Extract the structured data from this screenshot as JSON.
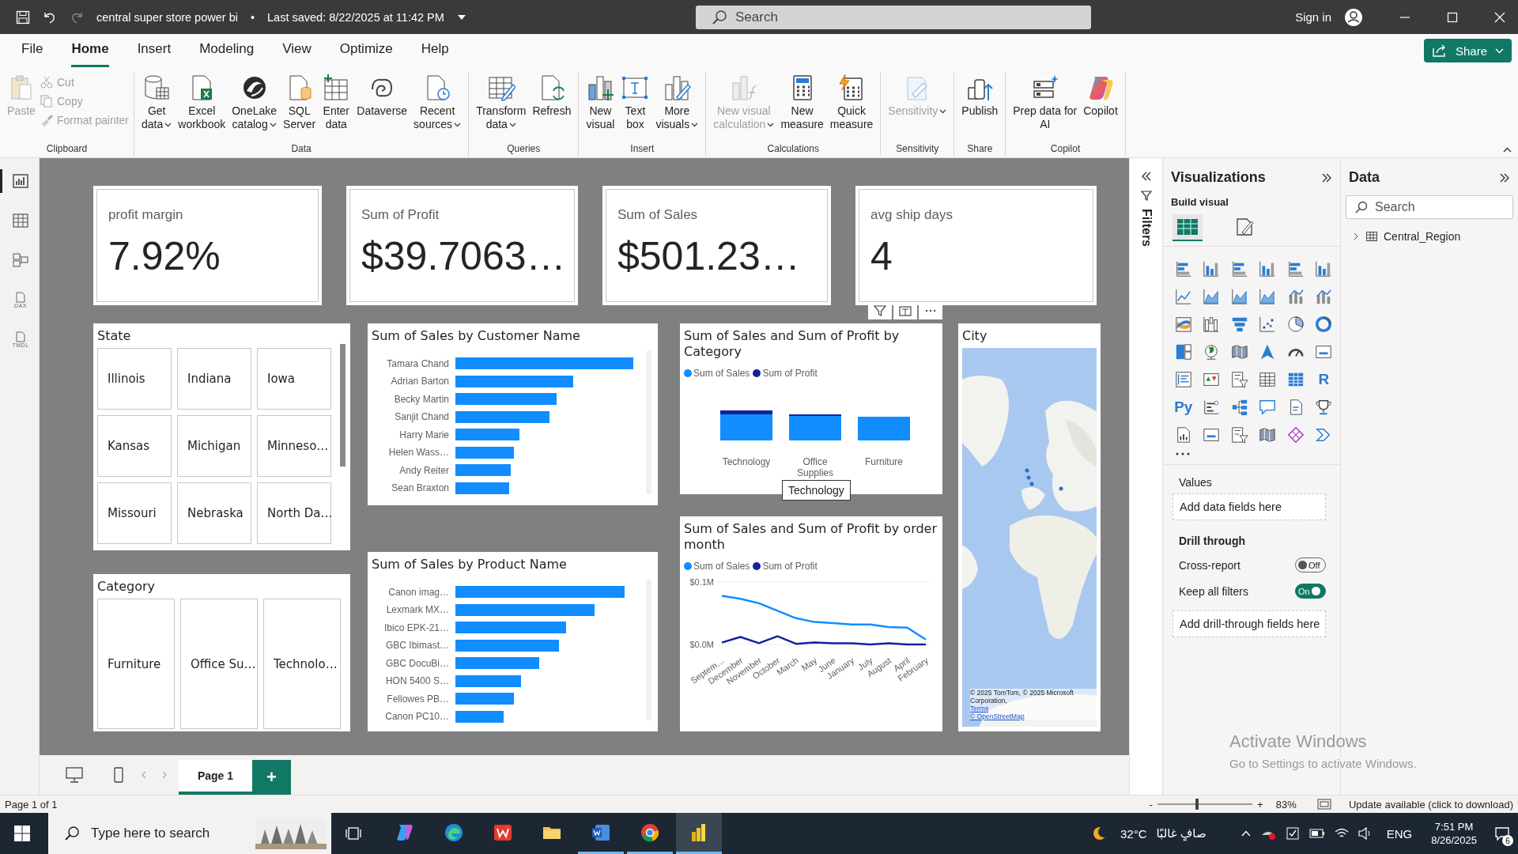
{
  "title_bar": {
    "document_title": "central super store power bi",
    "separator": "•",
    "last_saved": "Last saved: 8/22/2025 at 11:42 PM",
    "search": {
      "placeholder": "Search"
    },
    "sign_in": "Sign in"
  },
  "menu_tabs": [
    {
      "label": "File",
      "selected": false
    },
    {
      "label": "Home",
      "selected": true
    },
    {
      "label": "Insert",
      "selected": false
    },
    {
      "label": "Modeling",
      "selected": false
    },
    {
      "label": "View",
      "selected": false
    },
    {
      "label": "Optimize",
      "selected": false
    },
    {
      "label": "Help",
      "selected": false
    }
  ],
  "share_button": "Share",
  "ribbon": [
    {
      "label": "Clipboard",
      "buttons": [
        {
          "kind": "large",
          "lines": [
            "Paste"
          ],
          "disabled": true,
          "dropdown": false
        },
        {
          "kind": "small",
          "lines": [
            "Cut"
          ],
          "disabled": true,
          "dropdown": false
        },
        {
          "kind": "small",
          "lines": [
            "Copy"
          ],
          "disabled": true,
          "dropdown": false
        },
        {
          "kind": "small",
          "lines": [
            "Format painter"
          ],
          "disabled": true,
          "dropdown": false
        }
      ]
    },
    {
      "label": "Data",
      "buttons": [
        {
          "kind": "large",
          "lines": [
            "Get",
            "data"
          ],
          "disabled": false,
          "dropdown": true
        },
        {
          "kind": "large",
          "lines": [
            "Excel",
            "workbook"
          ],
          "disabled": false,
          "dropdown": false
        },
        {
          "kind": "large",
          "lines": [
            "OneLake",
            "catalog"
          ],
          "disabled": false,
          "dropdown": true
        },
        {
          "kind": "large",
          "lines": [
            "SQL",
            "Server"
          ],
          "disabled": false,
          "dropdown": false
        },
        {
          "kind": "large",
          "lines": [
            "Enter",
            "data"
          ],
          "disabled": false,
          "dropdown": false
        },
        {
          "kind": "large",
          "lines": [
            "Dataverse"
          ],
          "disabled": false,
          "dropdown": false
        },
        {
          "kind": "large",
          "lines": [
            "Recent",
            "sources"
          ],
          "disabled": false,
          "dropdown": true
        }
      ]
    },
    {
      "label": "Queries",
      "buttons": [
        {
          "kind": "large",
          "lines": [
            "Transform",
            "data"
          ],
          "disabled": false,
          "dropdown": true
        },
        {
          "kind": "large",
          "lines": [
            "Refresh"
          ],
          "disabled": false,
          "dropdown": false
        }
      ]
    },
    {
      "label": "Insert",
      "buttons": [
        {
          "kind": "large",
          "lines": [
            "New",
            "visual"
          ],
          "disabled": false,
          "dropdown": false
        },
        {
          "kind": "large",
          "lines": [
            "Text",
            "box"
          ],
          "disabled": false,
          "dropdown": false
        },
        {
          "kind": "large",
          "lines": [
            "More",
            "visuals"
          ],
          "disabled": false,
          "dropdown": true
        }
      ]
    },
    {
      "label": "Calculations",
      "buttons": [
        {
          "kind": "large",
          "lines": [
            "New visual",
            "calculation"
          ],
          "disabled": true,
          "dropdown": true
        },
        {
          "kind": "large",
          "lines": [
            "New",
            "measure"
          ],
          "disabled": false,
          "dropdown": false
        },
        {
          "kind": "large",
          "lines": [
            "Quick",
            "measure"
          ],
          "disabled": false,
          "dropdown": false
        }
      ]
    },
    {
      "label": "Sensitivity",
      "buttons": [
        {
          "kind": "large",
          "lines": [
            "Sensitivity"
          ],
          "disabled": true,
          "dropdown": true
        }
      ]
    },
    {
      "label": "Share",
      "buttons": [
        {
          "kind": "large",
          "lines": [
            "Publish"
          ],
          "disabled": false,
          "dropdown": false
        }
      ]
    },
    {
      "label": "Copilot",
      "buttons": [
        {
          "kind": "large",
          "lines": [
            "Prep data for",
            "AI"
          ],
          "disabled": false,
          "dropdown": false
        },
        {
          "kind": "large",
          "lines": [
            "Copilot"
          ],
          "disabled": false,
          "dropdown": false
        }
      ]
    }
  ],
  "left_nav": [
    {
      "kind": "report",
      "selected": true
    },
    {
      "kind": "table",
      "selected": false
    },
    {
      "kind": "model",
      "selected": false
    },
    {
      "kind": "dax",
      "label": "DAX",
      "selected": false
    },
    {
      "kind": "tmdl",
      "label": "TMDL",
      "selected": false
    }
  ],
  "cards": [
    {
      "title": "profit margin",
      "value": "7.92%"
    },
    {
      "title": "Sum of Profit",
      "value": "$39.7063…"
    },
    {
      "title": "Sum of Sales",
      "value": "$501.23…"
    },
    {
      "title": "avg ship days",
      "value": "4"
    }
  ],
  "slicers": [
    {
      "title": "State",
      "scrollable": true,
      "items": [
        "Illinois",
        "Indiana",
        "Iowa",
        "Kansas",
        "Michigan",
        "Minneso…",
        "Missouri",
        "Nebraska",
        "North Da…"
      ]
    },
    {
      "title": "Category",
      "scrollable": false,
      "items": [
        "Furniture",
        "Office Su…",
        "Technolo…"
      ]
    }
  ],
  "bar_charts": [
    {
      "title": "Sum of Sales by Customer Name",
      "bars": [
        {
          "label": "Tamara Chand"
        },
        {
          "label": "Adrian Barton"
        },
        {
          "label": "Becky Martin"
        },
        {
          "label": "Sanjit Chand"
        },
        {
          "label": "Harry Marie"
        },
        {
          "label": "Helen Wass…"
        },
        {
          "label": "Andy Reiter"
        },
        {
          "label": "Sean Braxton"
        }
      ]
    },
    {
      "title": "Sum of Sales by Product Name",
      "bars": [
        {
          "label": "Canon imag…"
        },
        {
          "label": "Lexmark MX…"
        },
        {
          "label": "Ibico EPK-21…"
        },
        {
          "label": "GBC Ibimast…"
        },
        {
          "label": "GBC DocuBi…"
        },
        {
          "label": "HON 5400 S…"
        },
        {
          "label": "Fellowes PB…"
        },
        {
          "label": "Canon PC10…"
        }
      ]
    }
  ],
  "category_chart": {
    "title": "Sum of Sales and Sum of Profit by Category",
    "legend": [
      {
        "label": "Sum of Sales",
        "color": "#118dff"
      },
      {
        "label": "Sum of Profit",
        "color": "#12239e"
      }
    ],
    "columns": [
      {
        "label": "Technology"
      },
      {
        "label": "Office Supplies"
      },
      {
        "label": "Furniture"
      }
    ],
    "tooltip": "Technology"
  },
  "month_chart": {
    "title": "Sum of Sales and Sum of Profit by order month",
    "chart_data": {
      "type": "line",
      "x": [
        "Septem…",
        "December",
        "November",
        "October",
        "March",
        "May",
        "June",
        "January",
        "July",
        "August",
        "April",
        "February"
      ],
      "ylim": [
        0,
        0.1
      ],
      "yticks": [
        {
          "value": 0,
          "label": "$0.0M"
        },
        {
          "value": 0.1,
          "label": "$0.1M"
        }
      ],
      "series": [
        {
          "name": "Sum of Sales",
          "color": "#118dff",
          "values": [
            0.078,
            0.073,
            0.066,
            0.054,
            0.042,
            0.036,
            0.034,
            0.032,
            0.032,
            0.028,
            0.027,
            0.008
          ]
        },
        {
          "name": "Sum of Profit",
          "color": "#12239e",
          "values": [
            0.003,
            0.012,
            0.002,
            0.013,
            0.001,
            0.003,
            0.002,
            0.002,
            0,
            0.002,
            0,
            0
          ]
        }
      ]
    }
  },
  "map": {
    "title": "City",
    "attribution": "© 2025 TomTom, © 2025 Microsoft Corporation,",
    "terms": "Terms",
    "osm": "© OpenStreetMap"
  },
  "filters_pane": {
    "label": "Filters"
  },
  "visualizations": {
    "title": "Visualizations",
    "subtitle": "Build visual",
    "modes": [
      {
        "selected": true
      },
      {
        "selected": false
      }
    ],
    "icons": [
      {
        "kind": "hbar"
      },
      {
        "kind": "vbar"
      },
      {
        "kind": "hbar"
      },
      {
        "kind": "vbar"
      },
      {
        "kind": "hbar"
      },
      {
        "kind": "vbar"
      },
      {
        "kind": "line"
      },
      {
        "kind": "area"
      },
      {
        "kind": "area"
      },
      {
        "kind": "area"
      },
      {
        "kind": "combo"
      },
      {
        "kind": "combo"
      },
      {
        "kind": "ribbon"
      },
      {
        "kind": "waterfall"
      },
      {
        "kind": "funnel"
      },
      {
        "kind": "scatter"
      },
      {
        "kind": "pie"
      },
      {
        "kind": "donut"
      },
      {
        "kind": "treemap"
      },
      {
        "kind": "globe"
      },
      {
        "kind": "filledmap"
      },
      {
        "kind": "arrow"
      },
      {
        "kind": "gauge"
      },
      {
        "kind": "card"
      },
      {
        "kind": "multirow"
      },
      {
        "kind": "kpi"
      },
      {
        "kind": "slicer"
      },
      {
        "kind": "table"
      },
      {
        "kind": "matrix"
      },
      {
        "kind": "letter",
        "label": "R"
      },
      {
        "kind": "letter",
        "label": "Py"
      },
      {
        "kind": "influencers"
      },
      {
        "kind": "tree"
      },
      {
        "kind": "bubble"
      },
      {
        "kind": "narrative"
      },
      {
        "kind": "trophy"
      },
      {
        "kind": "paginated"
      },
      {
        "kind": "card"
      },
      {
        "kind": "slicer"
      },
      {
        "kind": "filledmap"
      },
      {
        "kind": "diamond"
      },
      {
        "kind": "chevron"
      }
    ],
    "values": {
      "label": "Values",
      "drop_zone": "Add data fields here"
    },
    "drill": {
      "title": "Drill through",
      "toggles": [
        {
          "label": "Cross-report",
          "on": false,
          "state_text": "Off"
        },
        {
          "label": "Keep all filters",
          "on": true,
          "state_text": "On"
        }
      ],
      "drop_zone": "Add drill-through fields here"
    }
  },
  "data_pane": {
    "title": "Data",
    "search": {
      "placeholder": "Search"
    },
    "tree": [
      {
        "label": "Central_Region",
        "expanded": false
      }
    ]
  },
  "pages": {
    "tabs": [
      {
        "label": "Page 1",
        "selected": true
      }
    ],
    "add": "+"
  },
  "status_bar": {
    "page_info": "Page 1 of 1",
    "zoom": {
      "minus": "-",
      "plus": "+",
      "level": 0.4,
      "reading": "83%"
    },
    "update": "Update available (click to download)"
  },
  "taskbar": {
    "search": {
      "placeholder": "Type here to search"
    },
    "apps": [
      {
        "running": false,
        "selected": false
      },
      {
        "running": false,
        "selected": false
      },
      {
        "running": false,
        "selected": false
      },
      {
        "running": false,
        "selected": false
      },
      {
        "running": true,
        "selected": false
      },
      {
        "running": true,
        "selected": false
      },
      {
        "running": true,
        "selected": true
      }
    ],
    "weather": {
      "temp": "32°C",
      "condition": "صافٍ غالبًا"
    },
    "language": "ENG",
    "time": "7:51 PM",
    "date": "8/26/2025",
    "notifications": "6"
  },
  "activation": {
    "title": "Activate Windows",
    "subtitle": "Go to Settings to activate Windows."
  }
}
